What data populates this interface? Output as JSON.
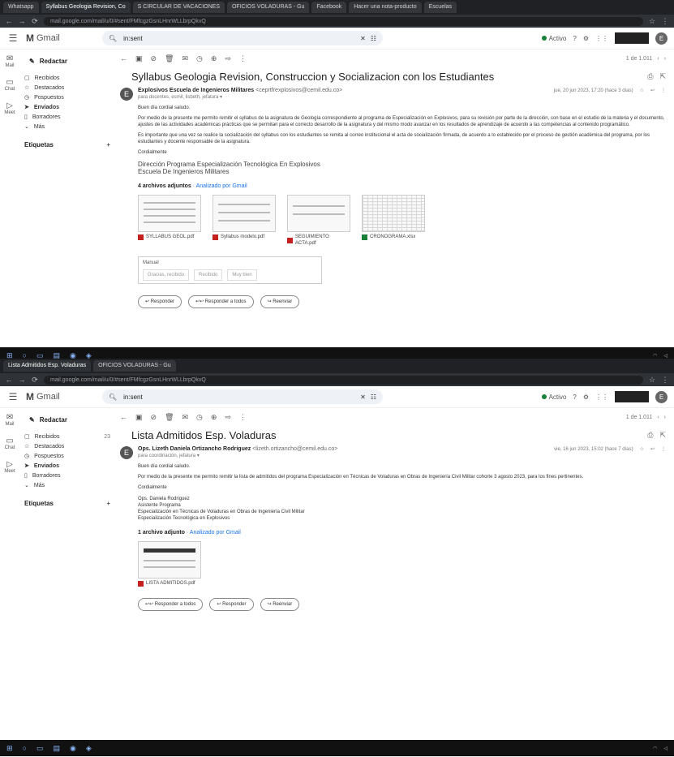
{
  "shot1": {
    "tabs": [
      "Whatsapp",
      "Syllabus Geologia Revision, Co",
      "S CIRCULAR DE VACACIONES",
      "OFICIOS VOLADURAS - Gu",
      "Facebook",
      "Hacer una nota-producto",
      "Escuelas"
    ],
    "url": "mail.google.com/mail/u/0/#sent/FMfcgzGsnLHnrWLLbrpQkvQ",
    "search_value": "in:sent",
    "status": "Activo",
    "toolbar_pager": "1 de 1.011",
    "subject": "Syllabus Geologia Revision, Construccion y Socializacion con los Estudiantes",
    "sender_name": "Explosivos Escuela de Ingenieros Militares",
    "sender_email": "<ceprtfrexplosivos@cemil.edu.co>",
    "to_line": "para docentes, esmil, lisbeth, jefatura ▾",
    "date": "jue, 20 jun 2023, 17:20 (hace 3 días)",
    "greeting": "Buen día cordial saludo.",
    "para1": "Por medio de la presente me permito remitir el syllabus de la asignatura de Geología correspondiente al programa de Especialización en Explosivos, para su revisión por parte de la dirección, con base en el estudio de la materia y el documento, ajustes de las actividades académicas prácticas que se permitan para el correcto desarrollo de la asignatura y del mismo modo avanzar en los resultados de aprendizaje de acuerdo a las competencias al contenido programático.",
    "para2": "Es importante que una vez se realice la socialización del syllabus con los estudiantes se remita al correo institucional el acta de socialización firmada, de acuerdo a lo establecido por el proceso de gestión académica del programa, por los estudiantes y docente responsable de la asignatura.",
    "closing": "Cordialmente",
    "signature_1": "Dirección Programa Especialización Tecnológica En Explosivos",
    "signature_2": "Escuela De Ingenieros Militares",
    "attachments_label": "4 archivos adjuntos",
    "attachments_scan": "· Analizado por Gmail",
    "attachments": [
      "SYLLABUS GEOL.pdf",
      "Syllabus modelo.pdf",
      "SEGUIMIENTO ACTA.pdf",
      "CRONOGRAMA.xlsx"
    ],
    "quick_reply_label": "Manual",
    "quick_chips": [
      "Gracias, recibido",
      "Recibido",
      "Muy bien"
    ],
    "reply": "Responder",
    "reply_all": "Responder a todos",
    "forward": "Reenviar"
  },
  "shot2": {
    "tabs": [
      "Lista Admitidos Esp. Voladuras",
      "OFICIOS VOLADURAS - Gu"
    ],
    "url": "mail.google.com/mail/u/0/#sent/FMfcgzGsnLHnrWLLbrpQkvQ",
    "search_value": "in:sent",
    "status": "Activo",
    "toolbar_pager": "1 de 1.011",
    "subject": "Lista Admitidos Esp. Voladuras",
    "sender_name": "Ops. Lizeth Daniela Ortizancho Rodriguez",
    "sender_email": "<lizeth.ortizancho@cemil.edu.co>",
    "to_line": "para coordinación, jefatura ▾",
    "date": "vie, 16 jun 2023, 15:02 (hace 7 días)",
    "greeting": "Buen día cordial saludo.",
    "para1": "Por medio de la presente me permito remitir la lista de admitidos del programa Especialización en Técnicas de Voladuras en Obras de Ingeniería Civil Militar cohorte 3 agosto 2023, para los fines pertinentes.",
    "closing": "Cordialmente",
    "signature": [
      "Ops. Daniela Rodriguez",
      "Asistente Programa",
      "Especialización en Técnicas de Voladuras en Obras de Ingeniería Civil Militar",
      "Especialización Tecnológica en Explosivos"
    ],
    "attachments_label": "1 archivo adjunto",
    "attachments_scan": "· Analizado por Gmail",
    "attachments": [
      "LISTA ADMITIDOS.pdf"
    ],
    "reply": "Responder",
    "reply_all": "Responder a todos",
    "forward": "Reenviar"
  },
  "common": {
    "app_name": "Gmail",
    "compose": "Redactar",
    "nav": [
      "Recibidos",
      "Destacados",
      "Pospuestos",
      "Enviados",
      "Borradores",
      "Más"
    ],
    "inbox_count": "23",
    "labels_title": "Etiquetas",
    "rail": [
      "Mail",
      "Chat",
      "Meet"
    ],
    "avatar_letter": "E"
  },
  "colors": {
    "browser_dark": "#202124",
    "active_green": "#188038",
    "pdf_red": "#c5221f",
    "link_blue": "#1a73e8"
  }
}
